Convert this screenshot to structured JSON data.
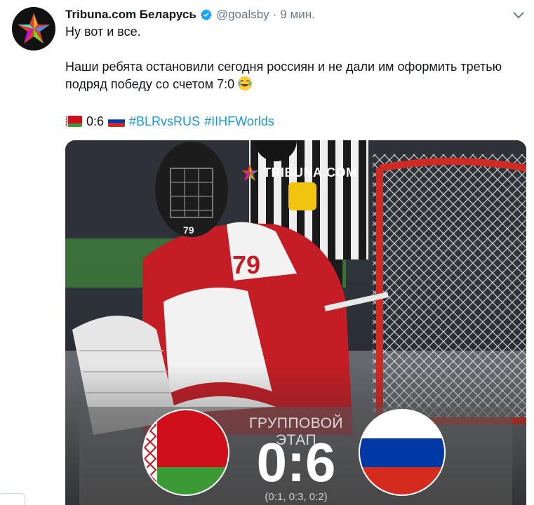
{
  "author": {
    "name": "Tribuna.com Беларусь",
    "handle": "@goalsby",
    "separator": "·",
    "time": "9 мин.",
    "verified_icon": "verified-badge-icon"
  },
  "tweet": {
    "line1": "Ну вот и все.",
    "line2": "Наши ребята остановили сегодня россиян и не дали им оформить третью подряд победу со счетом 7:0",
    "score": "0:6",
    "hashtags": [
      "#BLRvsRUS",
      "#IIHFWorlds"
    ]
  },
  "media": {
    "brand": "TRIBUNA.COM",
    "stage": "ГРУППОВОЙ ЭТАП",
    "score": "0:6",
    "periods": "(0:1, 0:3, 0:2)",
    "home_team_flag": "belarus-flag",
    "away_team_flag": "russia-flag",
    "goalie_number": "79"
  },
  "colors": {
    "link": "#1b95e0",
    "verified": "#1da1f2",
    "muted": "#657786",
    "belarus_red": "#cf101a",
    "belarus_green": "#3b9a36",
    "russia_blue": "#0039a6",
    "russia_red": "#d52b1e"
  }
}
